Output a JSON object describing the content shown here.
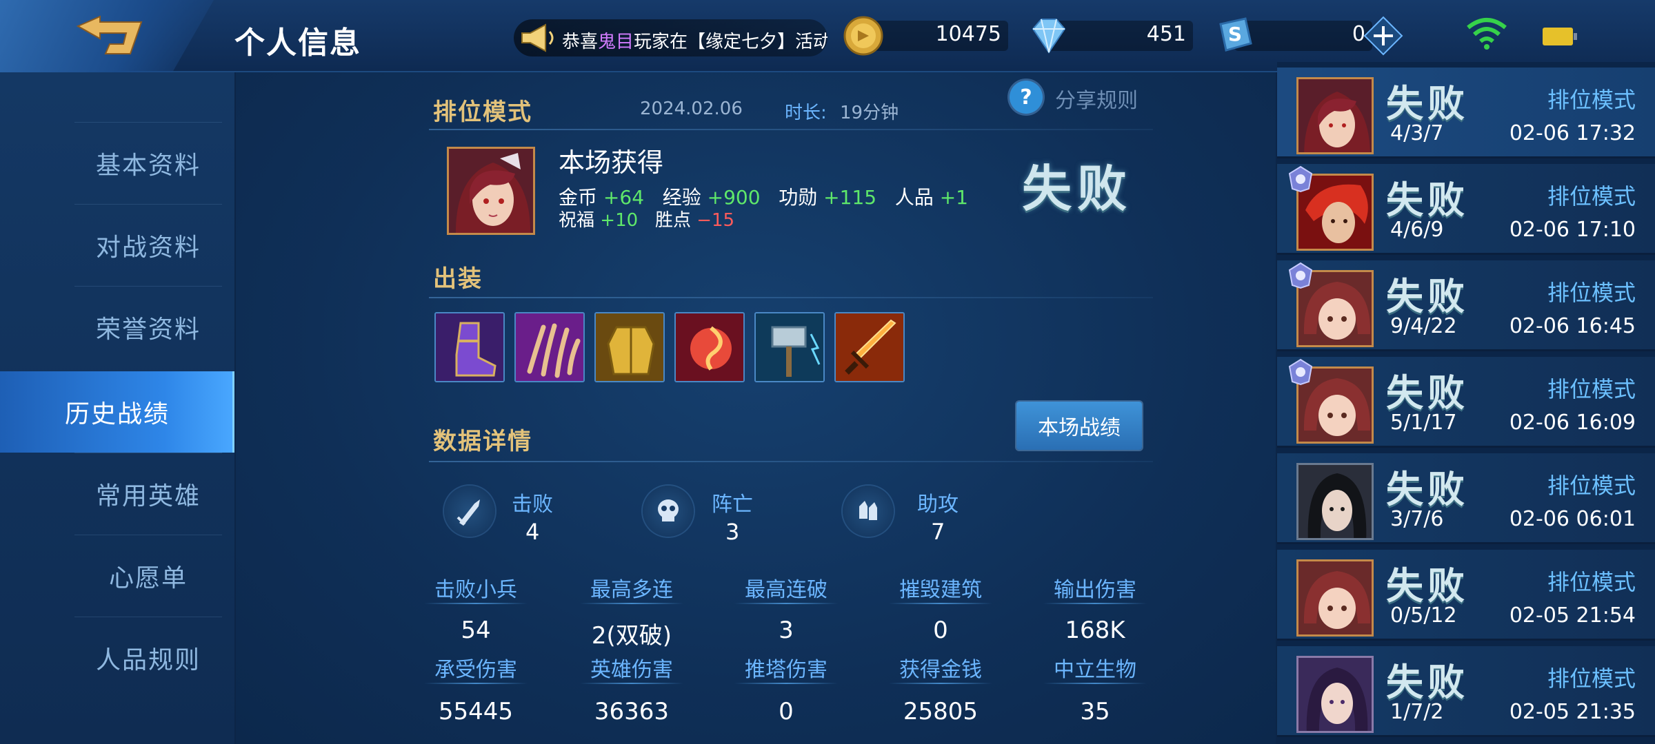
{
  "topbar": {
    "title": "个人信息",
    "ticker": {
      "prefix": "恭喜",
      "highlight": "鬼目",
      "suffix": "玩家在【缘定七夕】活动!"
    },
    "gold": "10475",
    "diamonds": "451",
    "tokens": "0"
  },
  "sidebar": {
    "items": [
      {
        "label": "基本资料"
      },
      {
        "label": "对战资料"
      },
      {
        "label": "荣誉资料"
      },
      {
        "label": "历史战绩"
      },
      {
        "label": "常用英雄"
      },
      {
        "label": "心愿单"
      },
      {
        "label": "人品规则"
      }
    ],
    "active_index": 3
  },
  "match": {
    "mode": "排位模式",
    "date": "2024.02.06",
    "duration_label": "时长:",
    "duration": "19分钟",
    "share_rules": "分享规则",
    "reward_title": "本场获得",
    "rewards": {
      "gold_label": "金币",
      "gold": "+64",
      "exp_label": "经验",
      "exp": "+900",
      "merit_label": "功勋",
      "merit": "+115",
      "karma_label": "人品",
      "karma": "+1",
      "blessing_label": "祝福",
      "blessing": "+10",
      "points_label": "胜点",
      "points": "−15"
    },
    "result": "失败",
    "equipment_title": "出装",
    "data_title": "数据详情",
    "match_stats_button": "本场战绩",
    "kda": [
      {
        "label": "击败",
        "value": "4"
      },
      {
        "label": "阵亡",
        "value": "3"
      },
      {
        "label": "助攻",
        "value": "7"
      }
    ],
    "stats_row1": [
      {
        "label": "击败小兵",
        "value": "54"
      },
      {
        "label": "最高多连",
        "value": "2(双破)"
      },
      {
        "label": "最高连破",
        "value": "3"
      },
      {
        "label": "摧毁建筑",
        "value": "0"
      },
      {
        "label": "输出伤害",
        "value": "168K"
      }
    ],
    "stats_row2": [
      {
        "label": "承受伤害",
        "value": "55445"
      },
      {
        "label": "英雄伤害",
        "value": "36363"
      },
      {
        "label": "推塔伤害",
        "value": "0"
      },
      {
        "label": "获得金钱",
        "value": "25805"
      },
      {
        "label": "中立生物",
        "value": "35"
      }
    ]
  },
  "history": [
    {
      "result": "失败",
      "mode": "排位模式",
      "kda": "4/3/7",
      "time": "02-06 17:32"
    },
    {
      "result": "失败",
      "mode": "排位模式",
      "kda": "4/6/9",
      "time": "02-06 17:10"
    },
    {
      "result": "失败",
      "mode": "排位模式",
      "kda": "9/4/22",
      "time": "02-06 16:45"
    },
    {
      "result": "失败",
      "mode": "排位模式",
      "kda": "5/1/17",
      "time": "02-06 16:09"
    },
    {
      "result": "失败",
      "mode": "排位模式",
      "kda": "3/7/6",
      "time": "02-06 06:01"
    },
    {
      "result": "失败",
      "mode": "排位模式",
      "kda": "0/5/12",
      "time": "02-05 21:54"
    },
    {
      "result": "失败",
      "mode": "排位模式",
      "kda": "1/7/2",
      "time": "02-05 21:35"
    }
  ],
  "colors": {
    "accent_gold": "#e3c27a",
    "accent_blue": "#6cb6ff",
    "positive": "#5fe86a",
    "negative": "#ff5b5b"
  },
  "icons": {
    "back": "back-arrow-icon",
    "horn": "horn-icon",
    "gold": "gold-coin-icon",
    "diamond": "diamond-icon",
    "token": "token-icon",
    "plus": "plus-icon",
    "wifi": "wifi-icon",
    "battery": "battery-icon",
    "help": "help-icon",
    "kills": "kills-icon",
    "deaths": "skull-icon",
    "assists": "assist-icon"
  }
}
